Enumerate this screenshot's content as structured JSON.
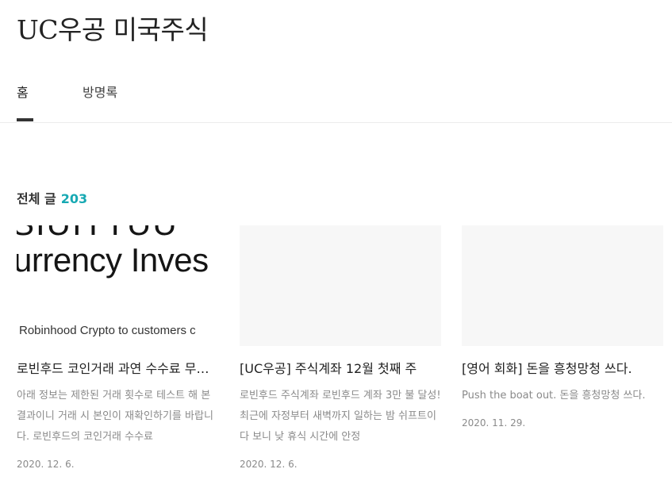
{
  "blog": {
    "title": "UC우공 미국주식"
  },
  "nav": {
    "items": [
      {
        "label": "홈"
      },
      {
        "label": "방명록"
      }
    ]
  },
  "section": {
    "title": "전체 글",
    "count": "203"
  },
  "posts": [
    {
      "thumb_top_text": "SIUITTUU",
      "thumb_main_text": "urrency Inves",
      "thumb_sub_text": "Robinhood Crypto to customers c",
      "title": "로빈후드 코인거래 과연 수수료 무료일까?",
      "excerpt": "아래 정보는 제한된 거래 횟수로 테스트 해 본 결과이니 거래 시 본인이 재확인하기를 바랍니다. 로빈후드의 코인거래 수수료",
      "date": "2020. 12. 6."
    },
    {
      "title": "[UC우공] 주식계좌 12월 첫째 주",
      "excerpt": "로빈후드 주식계좌 로빈후드 계좌 3만 불 달성! 최근에 자정부터 새벽까지 일하는 밤 쉬프트이다 보니 낮 휴식 시간에 안정",
      "date": "2020. 12. 6."
    },
    {
      "title": "[영어 회화] 돈을 흥청망청 쓰다.",
      "excerpt": "Push the boat out. 돈을 흥청망청 쓰다.",
      "date": "2020. 11. 29."
    }
  ]
}
